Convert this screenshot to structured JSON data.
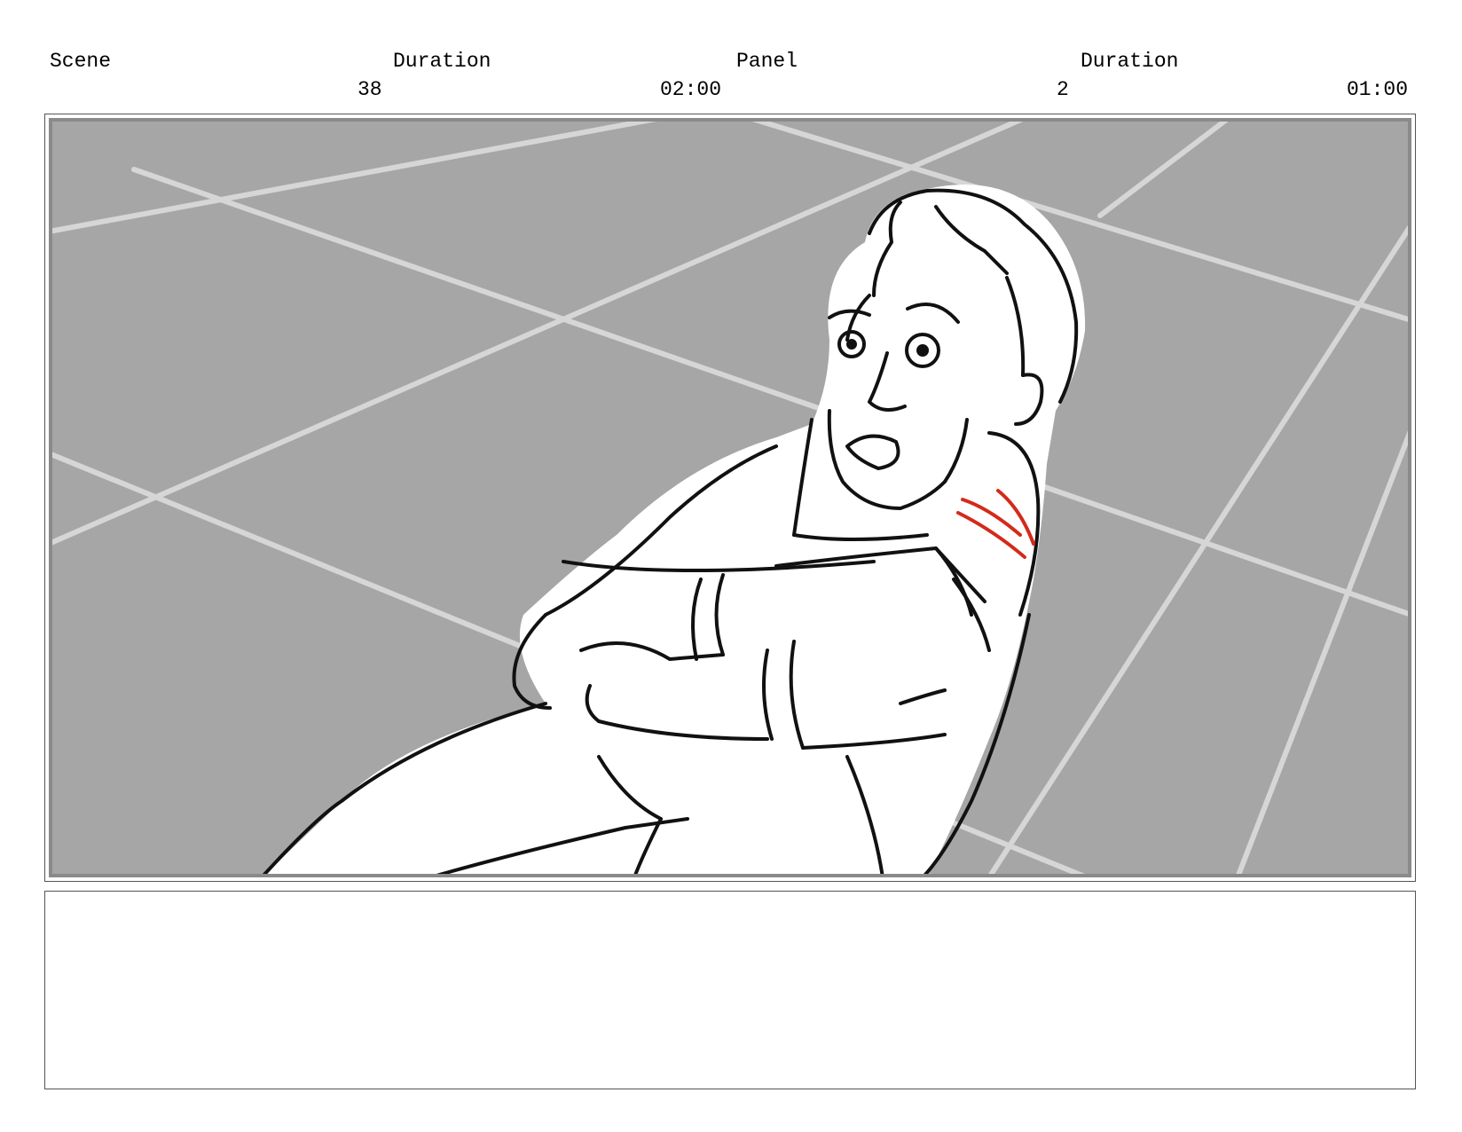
{
  "header": {
    "scene_label": "Scene",
    "scene_duration_label": "Duration",
    "panel_label": "Panel",
    "panel_duration_label": "Duration",
    "scene_value": "38",
    "scene_duration_value": "02:00",
    "panel_value": "2",
    "panel_duration_value": "01:00"
  },
  "artwork": {
    "floor_color": "#a6a6a6",
    "grid_line_color": "#d6d6d6",
    "ink_color": "#111111",
    "wound_color": "#d42a1a"
  },
  "notes": {
    "text": ""
  }
}
